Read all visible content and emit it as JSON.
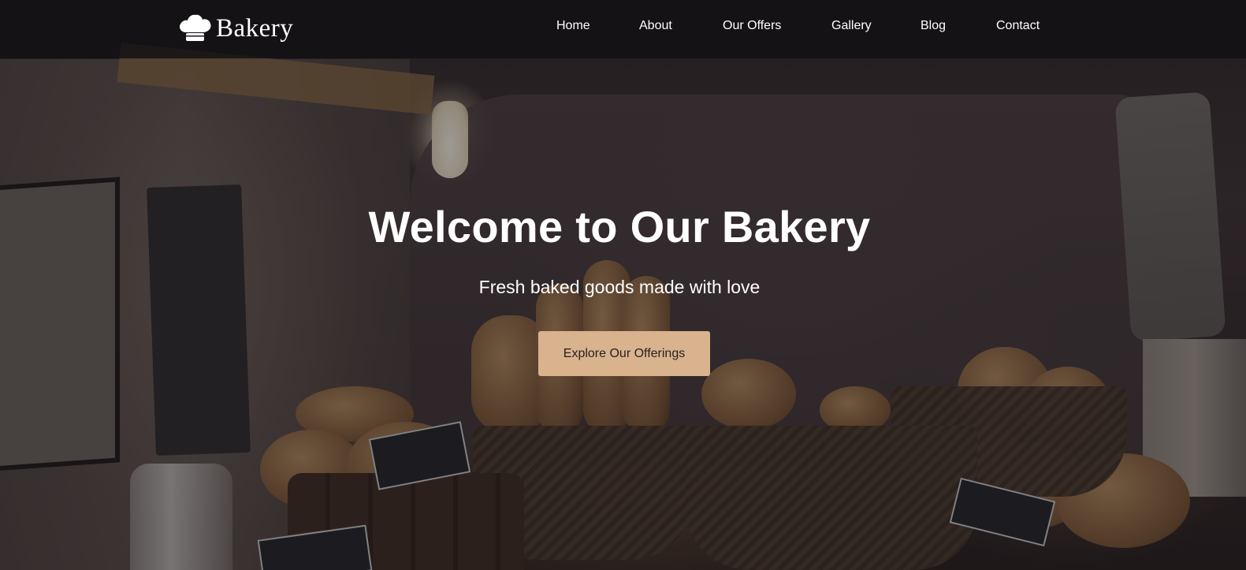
{
  "brand": {
    "name": "Bakery",
    "icon": "chef-hat-icon"
  },
  "nav": {
    "items": [
      {
        "label": "Home"
      },
      {
        "label": "About"
      },
      {
        "label": "Our Offers"
      },
      {
        "label": "Gallery"
      },
      {
        "label": "Blog"
      },
      {
        "label": "Contact"
      }
    ]
  },
  "hero": {
    "title": "Welcome to Our Bakery",
    "subtitle": "Fresh baked goods made with love",
    "cta_label": "Explore Our Offerings"
  },
  "colors": {
    "cta_background": "#d9b28e",
    "navbar_background": "#121014",
    "text": "#ffffff"
  }
}
